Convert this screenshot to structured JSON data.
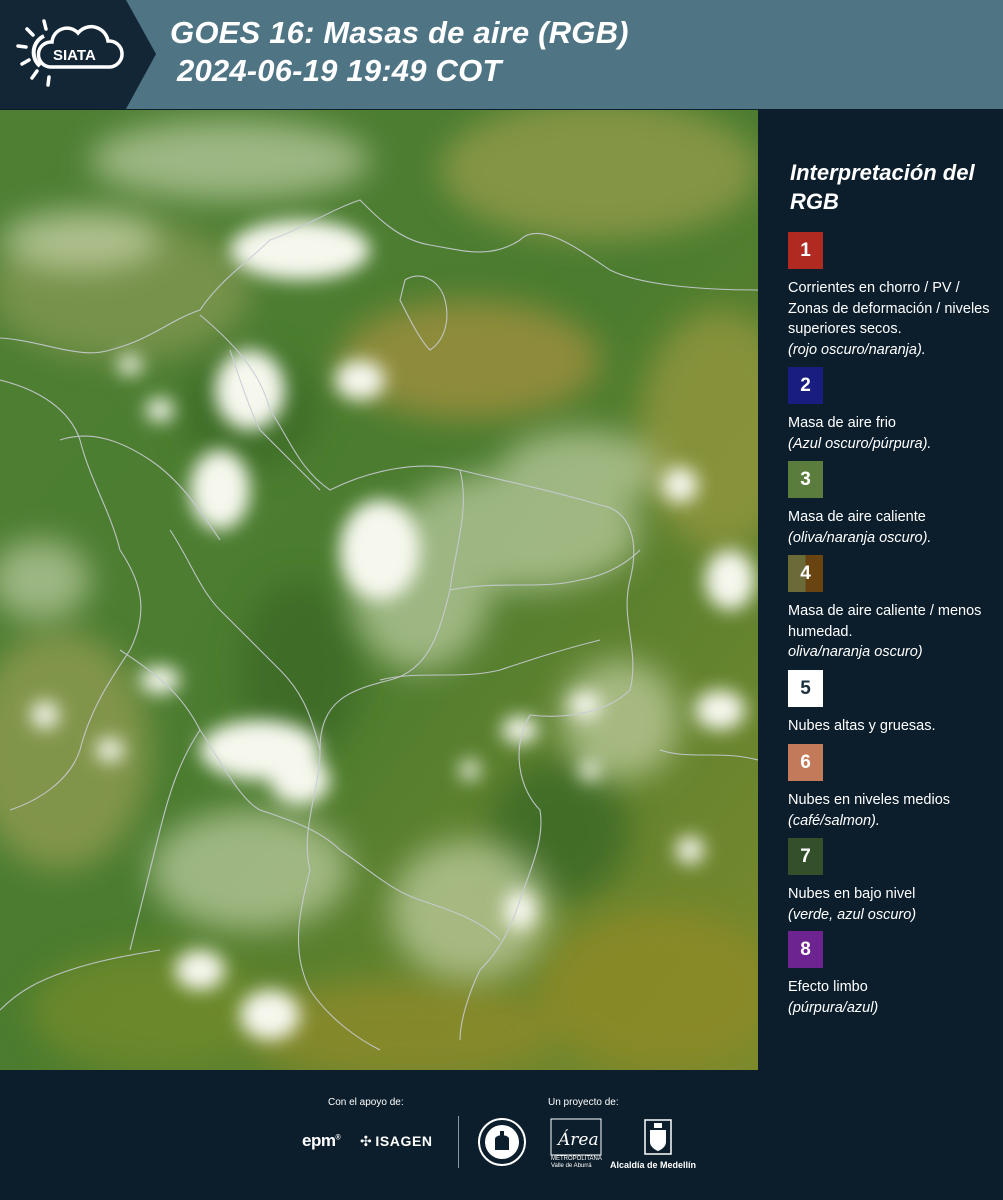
{
  "header": {
    "title_line1": "GOES 16: Masas de aire (RGB)",
    "title_line2": "2024-06-19 19:49 COT",
    "logo_text": "SIATA"
  },
  "legend": {
    "title": "Interpretación del RGB",
    "items": [
      {
        "num": "1",
        "color": "#b02a22",
        "label": "Corrientes en chorro / PV / Zonas de deformación / niveles superiores secos.",
        "hint": "(rojo oscuro/naranja)."
      },
      {
        "num": "2",
        "color": "#1a1d80",
        "label": "Masa de aire frio",
        "hint": "(Azul oscuro/púrpura)."
      },
      {
        "num": "3",
        "color": "#5a7d3e",
        "label": "Masa de aire caliente",
        "hint": "(oliva/naranja oscuro)."
      },
      {
        "num": "4",
        "color_a": "#6b6b3a",
        "color_b": "#6a4410",
        "label": "Masa de aire caliente / menos humedad.",
        "hint": "oliva/naranja oscuro)"
      },
      {
        "num": "5",
        "color": "#ffffff",
        "label": "Nubes altas y gruesas.",
        "hint": ""
      },
      {
        "num": "6",
        "color": "#c27a5a",
        "label": "Nubes en niveles medios",
        "hint": "(café/salmon)."
      },
      {
        "num": "7",
        "color": "#33502a",
        "label": "Nubes en bajo nivel",
        "hint": "(verde, azul oscuro)"
      },
      {
        "num": "8",
        "color": "#6d2390",
        "label": "Efecto limbo",
        "hint": "(púrpura/azul)"
      }
    ]
  },
  "footer": {
    "support_label": "Con el apoyo de:",
    "project_label": "Un proyecto de:",
    "epm": "epm",
    "isagen": "ISAGEN",
    "amva_text": "METROPOLITANA Valle de Aburrá",
    "amva_logo": "Área",
    "medellin": "Alcaldía de Medellín"
  },
  "colors": {
    "header": "#4f7585",
    "panel": "#0c1e2c",
    "logo_panel": "#132636"
  }
}
